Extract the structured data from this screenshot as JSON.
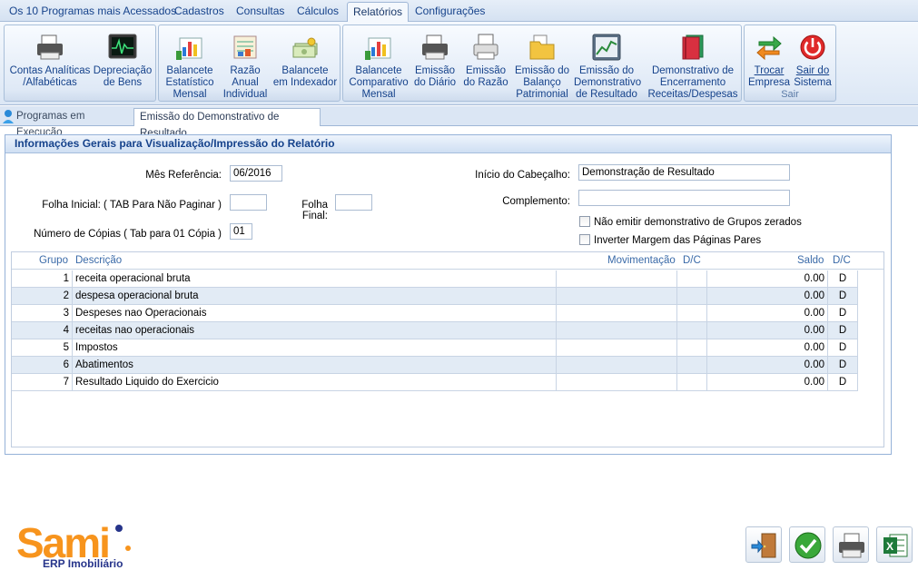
{
  "menu": {
    "tabs": [
      "Os 10 Programas mais Acessados",
      "Cadastros",
      "Consultas",
      "Cálculos",
      "Relatórios",
      "Configurações"
    ],
    "active": "Relatórios"
  },
  "ribbon": {
    "buttons": [
      {
        "line1": "Contas Analíticas",
        "line2": "/Alfabéticas",
        "line3": "",
        "icon": "printer-icon"
      },
      {
        "line1": "Depreciação",
        "line2": "de Bens",
        "line3": "",
        "icon": "monitor-graph-icon"
      },
      {
        "line1": "Balancete",
        "line2": "Estatístico",
        "line3": "Mensal",
        "icon": "bar-chart-icon"
      },
      {
        "line1": "Razão",
        "line2": "Anual",
        "line3": "Individual",
        "icon": "ledger-icon"
      },
      {
        "line1": "Balancete",
        "line2": "em Indexador",
        "line3": "",
        "icon": "money-icon"
      },
      {
        "line1": "Balancete",
        "line2": "Comparativo",
        "line3": "Mensal",
        "icon": "bar-chart-icon"
      },
      {
        "line1": "Emissão",
        "line2": "do Diário",
        "line3": "",
        "icon": "printer-icon"
      },
      {
        "line1": "Emissão",
        "line2": "do Razão",
        "line3": "",
        "icon": "printer-icon"
      },
      {
        "line1": "Emissão do",
        "line2": "Balanço",
        "line3": "Patrimonial",
        "icon": "folder-icon"
      },
      {
        "line1": "Emissão do",
        "line2": "Demonstrativo",
        "line3": "de Resultado",
        "icon": "line-chart-icon"
      },
      {
        "line1": "Demonstrativo de",
        "line2": "Encerramento",
        "line3": "Receitas/Despesas",
        "icon": "book-icon"
      }
    ],
    "exit": {
      "trocar_l1": "Trocar",
      "trocar_l2": "Empresa",
      "sair_l1": "Sair do",
      "sair_l2": "Sistema",
      "group_label": "Sair"
    }
  },
  "doc_tabs": [
    "Programas em Execução",
    "Emissão do Demonstrativo de Resultado"
  ],
  "panel": {
    "title": "Informações Gerais para Visualização/Impressão do Relatório",
    "labels": {
      "mes": "Mês Referência:",
      "folha_inicial": "Folha Inicial: ( TAB Para Não Paginar )",
      "folha_final": "Folha Final:",
      "copias": "Número de Cópias ( Tab para 01 Cópia )",
      "inicio_cab": "Início do Cabeçalho:",
      "complemento": "Complemento:"
    },
    "values": {
      "mes": "06/2016",
      "folha_inicial": "",
      "folha_final": "",
      "copias": "01",
      "inicio_cab": "Demonstração de Resultado",
      "complemento": ""
    },
    "checkboxes": [
      {
        "label": "Não emitir demonstrativo de Grupos zerados",
        "checked": false
      },
      {
        "label": "Inverter Margem das Páginas Pares",
        "checked": false
      }
    ]
  },
  "grid": {
    "columns": [
      "Grupo",
      "Descrição",
      "Movimentação",
      "D/C",
      "Saldo",
      "D/C"
    ],
    "rows": [
      {
        "grupo": "1",
        "descricao": "receita operacional bruta",
        "mov": "",
        "dc1": "",
        "saldo": "0.00",
        "dc2": "D"
      },
      {
        "grupo": "2",
        "descricao": "despesa operacional bruta",
        "mov": "",
        "dc1": "",
        "saldo": "0.00",
        "dc2": "D"
      },
      {
        "grupo": "3",
        "descricao": "Despeses nao Operacionais",
        "mov": "",
        "dc1": "",
        "saldo": "0.00",
        "dc2": "D"
      },
      {
        "grupo": "4",
        "descricao": "receitas nao operacionais",
        "mov": "",
        "dc1": "",
        "saldo": "0.00",
        "dc2": "D"
      },
      {
        "grupo": "5",
        "descricao": "Impostos",
        "mov": "",
        "dc1": "",
        "saldo": "0.00",
        "dc2": "D"
      },
      {
        "grupo": "6",
        "descricao": "Abatimentos",
        "mov": "",
        "dc1": "",
        "saldo": "0.00",
        "dc2": "D"
      },
      {
        "grupo": "7",
        "descricao": "Resultado Liquido do Exercicio",
        "mov": "",
        "dc1": "",
        "saldo": "0.00",
        "dc2": "D"
      }
    ]
  },
  "logo": {
    "brand": "Sami",
    "subtitle": "ERP Imobiliário"
  },
  "colors": {
    "accent": "#15428b",
    "logo_orange": "#f7941d",
    "logo_blue": "#26348a"
  }
}
